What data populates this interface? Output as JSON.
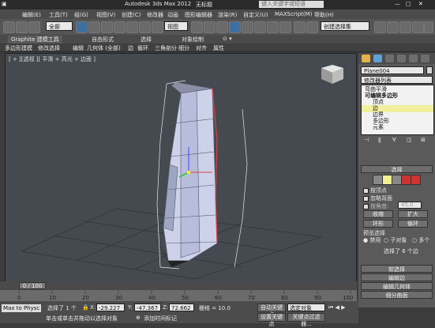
{
  "title": {
    "app": "Autodesk 3ds Max  2012",
    "doc": "无标题",
    "search_placeholder": "键入关键字或短语"
  },
  "menu": [
    "编辑(E)",
    "工具(T)",
    "组(G)",
    "视图(V)",
    "创建(C)",
    "修改器",
    "动画",
    "图形编辑器",
    "渲染(R)",
    "自定义(U)",
    "MAXScript(M)",
    "帮助(H)"
  ],
  "toolbar": {
    "select_filter": "全部",
    "view_dropdown": "视图",
    "selection_set": "创建选择集"
  },
  "ribbon": {
    "tabs": [
      "Graphite 建模工具",
      "自由形式",
      "选择",
      "对象绘制"
    ],
    "tools": [
      "多边形建模",
      "修改选择",
      "编辑",
      "几何体 (全部)",
      "边",
      "循环",
      "三角剖分",
      "细分",
      "对齐",
      "属性"
    ]
  },
  "viewport": {
    "label": "[ + ][透视 ][ 平滑 + 高光 + 边面 ]"
  },
  "panel": {
    "object_name": "Plane004",
    "modifier_list": "修改器列表",
    "stack": [
      "弯曲平滑",
      "可编辑多边形",
      "顶点",
      "边",
      "边界",
      "多边形",
      "元素"
    ],
    "selection_header": "选择",
    "by_vertex": "按顶点",
    "ignore_backfacing": "忽略背面",
    "by_angle": "按角度:",
    "angle_value": "45.0",
    "shrink": "收缩",
    "grow": "扩大",
    "ring": "环形",
    "loop": "循环",
    "preview_selection": "预览选择",
    "preview_options": [
      "禁用",
      "子对象",
      "多个"
    ],
    "selected_count": "选择了 6 个边",
    "rollouts": [
      "软选择",
      "编辑边",
      "编辑几何体",
      "细分曲面"
    ]
  },
  "timeline": {
    "frame": "0 / 100",
    "ticks": [
      "0",
      "10",
      "20",
      "30",
      "40",
      "50",
      "60",
      "70",
      "80",
      "90",
      "100"
    ]
  },
  "status": {
    "selected": "选择了 1 个",
    "x_label": "X:",
    "x": "-29.227",
    "y_label": "Y:",
    "y": "-47.367",
    "z_label": "Z:",
    "z": "72.662",
    "grid": "栅格 = 10.0",
    "autokey": "自动关键点",
    "set_key": "设置关键点",
    "key_filter": "选定对象",
    "key_filters_btn": "关键点过滤器...",
    "add_time_tag": "添加时间标记",
    "prompt": "单击或单击并拖动以选择对象",
    "script_listener": "Max to Physc"
  },
  "colors": {
    "accent": "#f2ef8f",
    "viewport_bg": "#444a50",
    "selected_edge": "#e04040"
  }
}
